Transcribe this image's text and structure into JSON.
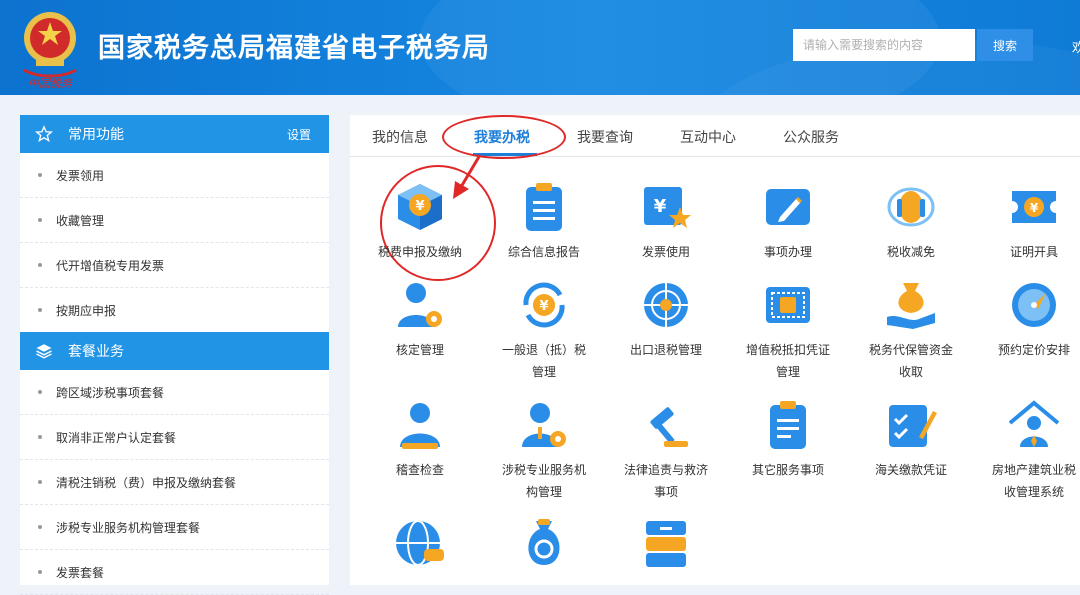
{
  "header": {
    "site_title": "国家税务总局福建省电子税务局",
    "search_placeholder": "请输入需要搜索的内容",
    "search_label": "搜索",
    "extra": "欢"
  },
  "sidebar": {
    "sec1_title": "常用功能",
    "sec1_settings": "设置",
    "sec1_items": [
      "发票领用",
      "收藏管理",
      "代开增值税专用发票",
      "按期应申报"
    ],
    "sec2_title": "套餐业务",
    "sec2_items": [
      "跨区域涉税事项套餐",
      "取消非正常户认定套餐",
      "清税注销税（费）申报及缴纳套餐",
      "涉税专业服务机构管理套餐",
      "发票套餐"
    ]
  },
  "tabs": [
    "我的信息",
    "我要办税",
    "我要查询",
    "互动中心",
    "公众服务"
  ],
  "active_tab": "我要办税",
  "tiles": {
    "r1": [
      "税费申报及缴纳",
      "综合信息报告",
      "发票使用",
      "事项办理",
      "税收减免",
      "证明开具"
    ],
    "r2a": [
      "核定管理",
      "一般退（抵）税",
      "出口退税管理",
      "增值税抵扣凭证",
      "税务代保管资金",
      "预约定价安排"
    ],
    "r2b": [
      "",
      "管理",
      "",
      "管理",
      "收取",
      ""
    ],
    "r3a": [
      "稽查检查",
      "涉税专业服务机",
      "法律追责与救济",
      "其它服务事项",
      "海关缴款凭证",
      "房地产建筑业税"
    ],
    "r3b": [
      "",
      "构管理",
      "事项",
      "",
      "",
      "收管理系统"
    ]
  },
  "colors": {
    "primary": "#1e7fd9",
    "header": "#0f7bd6",
    "accent_red": "#e02828",
    "icon_orange": "#f5a623"
  }
}
